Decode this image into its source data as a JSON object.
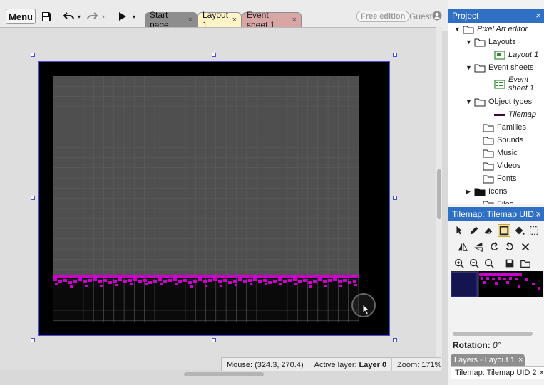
{
  "toolbar": {
    "menu_label": "Menu",
    "save_icon": "floppy-disk-icon",
    "undo_icon": "undo-icon",
    "redo_icon": "redo-icon",
    "play_icon": "play-icon",
    "dropdown_glyph": "▾",
    "free_edition": "Free edition",
    "guest": "Guest"
  },
  "tabs": [
    {
      "label": "Start page",
      "close": "×"
    },
    {
      "label": "Layout 1",
      "close": "×"
    },
    {
      "label": "Event sheet 1",
      "close": "×"
    }
  ],
  "status": {
    "mouse": "Mouse: (324.3, 270.4)",
    "active_layer_label": "Active layer:",
    "active_layer_value": "Layer 0",
    "zoom": "Zoom: 171%"
  },
  "project_panel": {
    "title": "Project",
    "close": "×",
    "tree": [
      {
        "label": "Pixel Art editor",
        "italic": true,
        "arrow": "▼",
        "icon": "folder-icon"
      },
      {
        "label": "Layouts",
        "italic": false,
        "arrow": "▼",
        "icon": "folder-icon"
      },
      {
        "label": "Layout 1",
        "italic": true,
        "arrow": "",
        "icon": "layout-icon"
      },
      {
        "label": "Event sheets",
        "italic": false,
        "arrow": "▼",
        "icon": "folder-icon"
      },
      {
        "label": "Event",
        "label2": "sheet 1",
        "italic": true,
        "arrow": "",
        "icon": "event-sheet-icon"
      },
      {
        "label": "Object types",
        "italic": false,
        "arrow": "▼",
        "icon": "folder-icon"
      },
      {
        "label": "Tilemap",
        "italic": true,
        "arrow": "",
        "icon": "tilemap-icon"
      },
      {
        "label": "Families",
        "italic": false,
        "arrow": "",
        "icon": "folder-icon"
      },
      {
        "label": "Sounds",
        "italic": false,
        "arrow": "",
        "icon": "folder-icon"
      },
      {
        "label": "Music",
        "italic": false,
        "arrow": "",
        "icon": "folder-icon"
      },
      {
        "label": "Videos",
        "italic": false,
        "arrow": "",
        "icon": "folder-icon"
      },
      {
        "label": "Fonts",
        "italic": false,
        "arrow": "",
        "icon": "folder-icon"
      },
      {
        "label": "Icons",
        "italic": false,
        "arrow": "▶",
        "icon": "folder-filled-icon"
      },
      {
        "label": "Files",
        "italic": false,
        "arrow": "",
        "icon": "folder-icon"
      }
    ]
  },
  "tilemap_panel": {
    "title": "Tilemap: Tilemap UID...",
    "close": "×",
    "tools": [
      [
        "pointer-icon",
        "pencil-icon",
        "eraser-icon",
        "rectangle-icon",
        "fill-bucket-icon",
        "select-rect-icon"
      ],
      [
        "mirror-icon",
        "flip-icon",
        "rotate-ccw-icon",
        "rotate-cw-icon",
        "clear-icon"
      ],
      [
        "zoom-in-icon",
        "zoom-out-icon",
        "zoom-reset-icon",
        "save-tiles-icon",
        "open-folder-icon"
      ]
    ],
    "selected_tool": "rectangle-icon",
    "rotation_label": "Rotation:",
    "rotation_value": "0°"
  },
  "bottom_tabs": {
    "layers": "Layers - Layout 1",
    "layers_close": "×",
    "tilemap": "Tilemap: Tilemap UID 2",
    "tilemap_close": "×"
  },
  "colors": {
    "accent": "#2f6fc4",
    "tile_magenta": "#cc00cc",
    "viewport_grey": "#4f4f4f",
    "selection_blue": "#4a4ae0"
  }
}
